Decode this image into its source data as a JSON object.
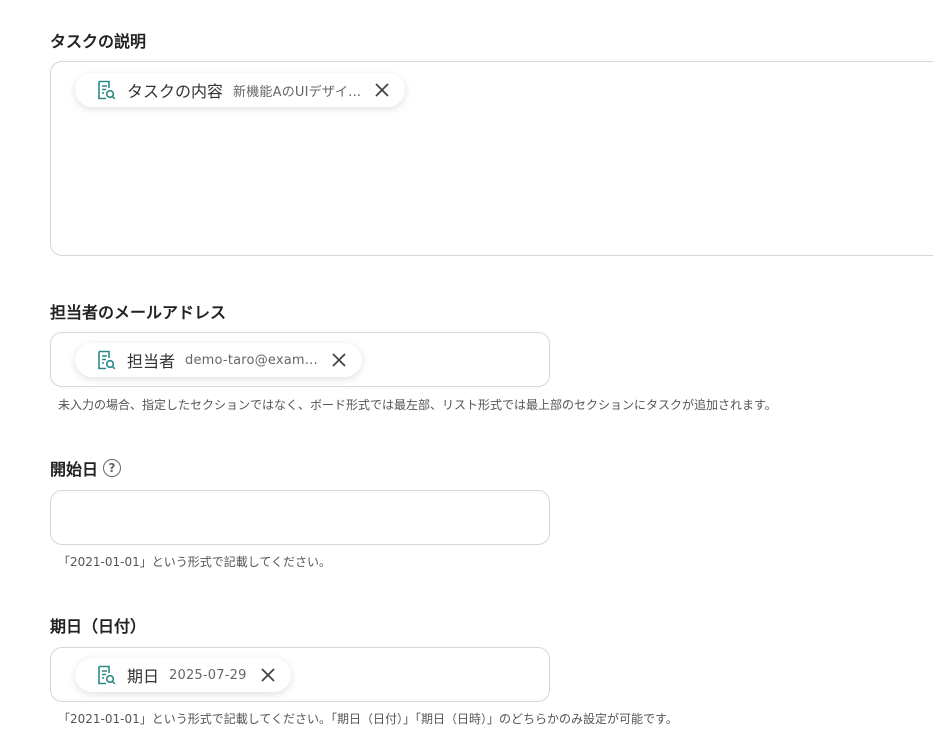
{
  "fields": {
    "description": {
      "label": "タスクの説明",
      "chip": {
        "label": "タスクの内容",
        "value": "新機能AのUIデザイ..."
      }
    },
    "assignee": {
      "label": "担当者のメールアドレス",
      "chip": {
        "label": "担当者",
        "value": "demo-taro@exam..."
      },
      "help": "未入力の場合、指定したセクションではなく、ボード形式では最左部、リスト形式では最上部のセクションにタスクが追加されます。"
    },
    "start_date": {
      "label": "開始日",
      "help_icon": "question-circle-icon",
      "value": "",
      "help": "「2021-01-01」という形式で記載してください。"
    },
    "due_date": {
      "label": "期日（日付）",
      "chip": {
        "label": "期日",
        "value": "2025-07-29"
      },
      "help": "「2021-01-01」という形式で記載してください。「期日（日付）」「期日（日時）」のどちらかのみ設定が可能です。"
    }
  },
  "icons": {
    "chip": "document-search-icon",
    "remove": "close-icon"
  },
  "colors": {
    "chip_icon": "#2a8a8a",
    "border": "#d4d6db"
  }
}
